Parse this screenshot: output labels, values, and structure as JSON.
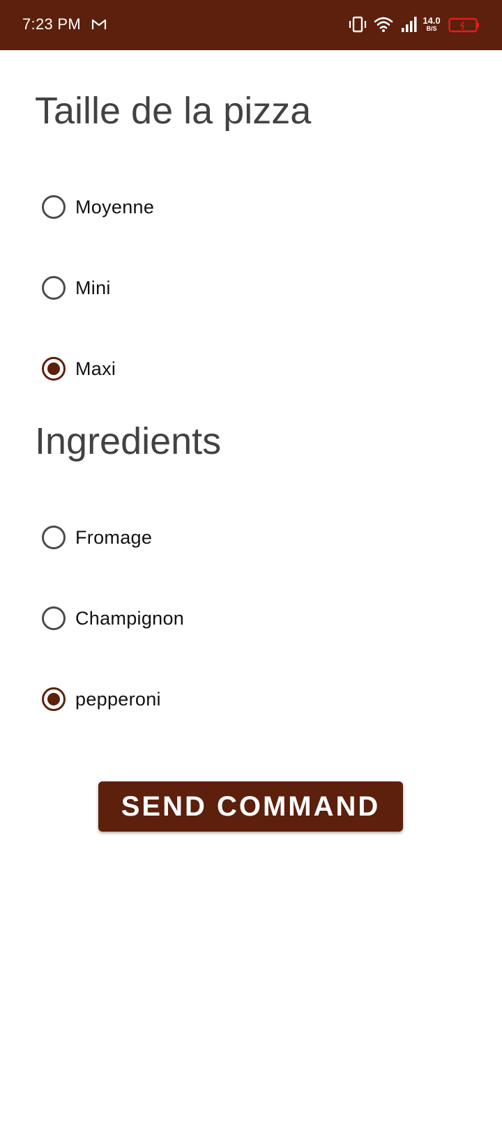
{
  "status_bar": {
    "time": "7:23 PM",
    "net_speed_value": "14.0",
    "net_speed_unit": "B/S",
    "background_color": "#5c200c",
    "icons": [
      "gmail-icon",
      "vibrate-icon",
      "wifi-icon",
      "signal-icon",
      "battery-icon"
    ],
    "battery_color": "#e0201a"
  },
  "pizza_size": {
    "title": "Taille de la pizza",
    "options": [
      {
        "label": "Moyenne",
        "checked": false
      },
      {
        "label": "Mini",
        "checked": false
      },
      {
        "label": "Maxi",
        "checked": true
      }
    ]
  },
  "ingredients": {
    "title": "Ingredients",
    "options": [
      {
        "label": "Fromage",
        "checked": false
      },
      {
        "label": "Champignon",
        "checked": false
      },
      {
        "label": "pepperoni",
        "checked": true
      }
    ]
  },
  "actions": {
    "send_label": "SEND COMMAND"
  },
  "colors": {
    "accent": "#5c200c",
    "title_text": "#424242",
    "unchecked_radio": "#4a4a4a"
  }
}
